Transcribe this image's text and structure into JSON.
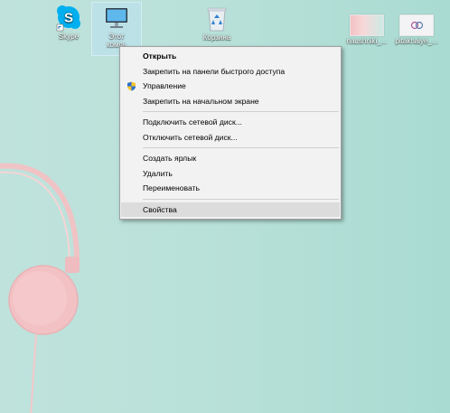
{
  "desktop": {
    "icons": [
      {
        "label": "Skype",
        "icon": "skype-icon"
      },
      {
        "label": "Этот компьютер",
        "label_line1": "Этот",
        "label_line2": "компь",
        "icon": "computer-icon"
      },
      {
        "label": "Корзина",
        "icon": "recycle-bin-icon"
      },
      {
        "label": "naushniki_...",
        "icon": "image-file-icon"
      },
      {
        "label": "pitakhaiye_...",
        "icon": "image-file-icon"
      }
    ]
  },
  "context_menu": {
    "items": [
      {
        "label": "Открыть",
        "bold": true
      },
      {
        "label": "Закрепить на панели быстрого доступа"
      },
      {
        "label": "Управление",
        "icon": "uac-shield-icon"
      },
      {
        "label": "Закрепить на начальном экране"
      },
      {
        "label": "Подключить сетевой диск..."
      },
      {
        "label": "Отключить сетевой диск..."
      },
      {
        "label": "Создать ярлык"
      },
      {
        "label": "Удалить"
      },
      {
        "label": "Переименовать"
      },
      {
        "label": "Свойства",
        "hovered": true
      }
    ]
  },
  "colors": {
    "wallpaper": "#b9e1d9",
    "headphones": "#f2c1c4",
    "menu_background": "#f2f2f2",
    "menu_hover": "#dcdcdc",
    "skype_blue": "#00aff0"
  }
}
